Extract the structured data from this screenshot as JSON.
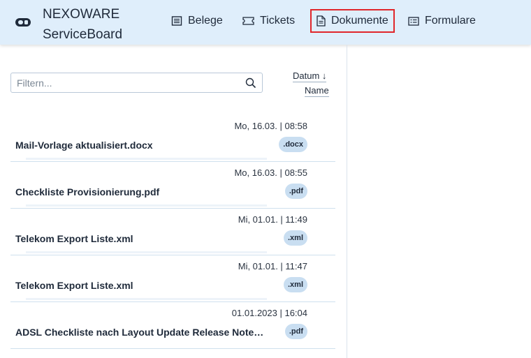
{
  "header": {
    "brand_line1": "NEXOWARE",
    "brand_line2": "ServiceBoard",
    "nav": [
      {
        "label": "Belege",
        "icon": "receipt-icon"
      },
      {
        "label": "Tickets",
        "icon": "ticket-icon"
      },
      {
        "label": "Dokumente",
        "icon": "document-icon",
        "active": true
      },
      {
        "label": "Formulare",
        "icon": "form-icon"
      }
    ]
  },
  "filter": {
    "placeholder": "Filtern..."
  },
  "sort": {
    "date_label": "Datum ↓",
    "name_label": "Name"
  },
  "documents": [
    {
      "date": "Mo, 16.03. | 08:58",
      "name": "Mail-Vorlage aktualisiert.docx",
      "ext": ".docx"
    },
    {
      "date": "Mo, 16.03. | 08:55",
      "name": "Checkliste Provisionierung.pdf",
      "ext": ".pdf"
    },
    {
      "date": "Mi, 01.01. | 11:49",
      "name": "Telekom Export Liste.xml",
      "ext": ".xml"
    },
    {
      "date": "Mi, 01.01. | 11:47",
      "name": "Telekom Export Liste.xml",
      "ext": ".xml"
    },
    {
      "date": "01.01.2023 | 16:04",
      "name": "ADSL Checkliste nach Layout Update Release Notes.pdf",
      "ext": ".pdf"
    }
  ],
  "colors": {
    "header_bg": "#dfeefb",
    "active_border": "#e0262b",
    "badge_bg": "#c9def1"
  }
}
